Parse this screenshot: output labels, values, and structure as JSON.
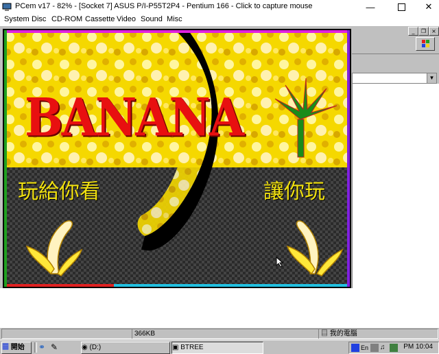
{
  "window": {
    "title": "PCem v17 - 82% - [Socket 7] ASUS P/I-P55T2P4 - Pentium 166 - Click to capture mouse",
    "minimize_icon": "minimize-icon",
    "maximize_icon": "maximize-icon",
    "close_icon": "close-icon"
  },
  "menu": [
    "System",
    "Disc",
    "CD-ROM",
    "Cassette",
    "Video",
    "Sound",
    "Misc"
  ],
  "game": {
    "title": "BANANA",
    "left_caption": "玩給你看",
    "right_caption": "讓你玩"
  },
  "statusbar": {
    "size": "366KB",
    "computer": "我的電腦"
  },
  "taskbar": {
    "start_label": "開始",
    "drive_label": "(D:)",
    "task_label": "BTREE",
    "clock": "PM 10:04"
  },
  "colors": {
    "title_red": "#e81010",
    "caption_yellow": "#f0e010",
    "banana_yellow": "#ffe83a",
    "palm_green": "#1a8c1a"
  }
}
